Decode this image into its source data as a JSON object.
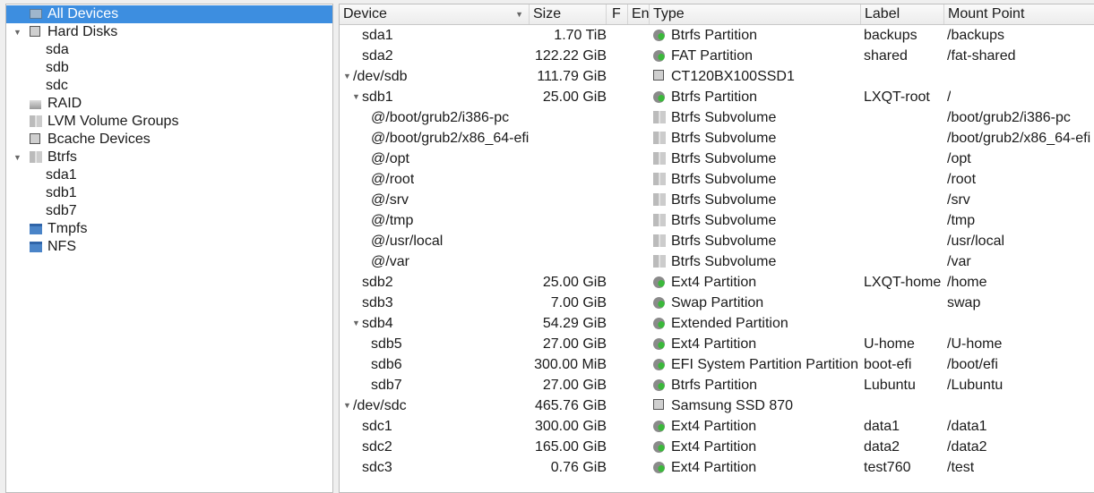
{
  "sidebar": {
    "items": [
      {
        "label": "All Devices",
        "icon": "monitor-icon",
        "level": 0,
        "selected": true
      },
      {
        "label": "Hard Disks",
        "icon": "disk-icon",
        "level": 0,
        "expanded": true
      },
      {
        "label": "sda",
        "level": 1
      },
      {
        "label": "sdb",
        "level": 1
      },
      {
        "label": "sdc",
        "level": 1
      },
      {
        "label": "RAID",
        "icon": "raid-icon",
        "level": 0
      },
      {
        "label": "LVM Volume Groups",
        "icon": "lvm-icon",
        "level": 0
      },
      {
        "label": "Bcache Devices",
        "icon": "disk-icon",
        "level": 0
      },
      {
        "label": "Btrfs",
        "icon": "lvm-icon",
        "level": 0,
        "expanded": true
      },
      {
        "label": "sda1",
        "level": 1
      },
      {
        "label": "sdb1",
        "level": 1
      },
      {
        "label": "sdb7",
        "level": 1
      },
      {
        "label": "Tmpfs",
        "icon": "folder-icon",
        "level": 0
      },
      {
        "label": "NFS",
        "icon": "network-folder-icon",
        "level": 0
      }
    ]
  },
  "table": {
    "columns": [
      "Device",
      "Size",
      "F",
      "En",
      "Type",
      "Label",
      "Mount Point"
    ],
    "sort_column": "Device",
    "rows": [
      {
        "device": "sda1",
        "level": 1,
        "size": "1.70 TiB",
        "type": "Btrfs Partition",
        "icon": "partition",
        "label": "backups",
        "mount": "/backups"
      },
      {
        "device": "sda2",
        "level": 1,
        "size": "122.22 GiB",
        "type": "FAT Partition",
        "icon": "partition",
        "label": "shared",
        "mount": "/fat-shared"
      },
      {
        "device": "/dev/sdb",
        "level": 0,
        "expanded": true,
        "size": "111.79 GiB",
        "type": "CT120BX100SSD1",
        "icon": "disk",
        "label": "",
        "mount": ""
      },
      {
        "device": "sdb1",
        "level": 1,
        "expanded": true,
        "size": "25.00 GiB",
        "type": "Btrfs Partition",
        "icon": "partition",
        "label": "LXQT-root",
        "mount": "/"
      },
      {
        "device": "@/boot/grub2/i386-pc",
        "level": 2,
        "size": "",
        "type": "Btrfs Subvolume",
        "icon": "subvolume",
        "label": "",
        "mount": "/boot/grub2/i386-pc"
      },
      {
        "device": "@/boot/grub2/x86_64-efi",
        "level": 2,
        "size": "",
        "type": "Btrfs Subvolume",
        "icon": "subvolume",
        "label": "",
        "mount": "/boot/grub2/x86_64-efi"
      },
      {
        "device": "@/opt",
        "level": 2,
        "size": "",
        "type": "Btrfs Subvolume",
        "icon": "subvolume",
        "label": "",
        "mount": "/opt"
      },
      {
        "device": "@/root",
        "level": 2,
        "size": "",
        "type": "Btrfs Subvolume",
        "icon": "subvolume",
        "label": "",
        "mount": "/root"
      },
      {
        "device": "@/srv",
        "level": 2,
        "size": "",
        "type": "Btrfs Subvolume",
        "icon": "subvolume",
        "label": "",
        "mount": "/srv"
      },
      {
        "device": "@/tmp",
        "level": 2,
        "size": "",
        "type": "Btrfs Subvolume",
        "icon": "subvolume",
        "label": "",
        "mount": "/tmp"
      },
      {
        "device": "@/usr/local",
        "level": 2,
        "size": "",
        "type": "Btrfs Subvolume",
        "icon": "subvolume",
        "label": "",
        "mount": "/usr/local"
      },
      {
        "device": "@/var",
        "level": 2,
        "size": "",
        "type": "Btrfs Subvolume",
        "icon": "subvolume",
        "label": "",
        "mount": "/var"
      },
      {
        "device": "sdb2",
        "level": 1,
        "size": "25.00 GiB",
        "type": "Ext4 Partition",
        "icon": "partition",
        "label": "LXQT-home",
        "mount": "/home"
      },
      {
        "device": "sdb3",
        "level": 1,
        "size": "7.00 GiB",
        "type": "Swap Partition",
        "icon": "partition",
        "label": "",
        "mount": "swap"
      },
      {
        "device": "sdb4",
        "level": 1,
        "expanded": true,
        "size": "54.29 GiB",
        "type": "Extended Partition",
        "icon": "partition",
        "label": "",
        "mount": ""
      },
      {
        "device": "sdb5",
        "level": 2,
        "size": "27.00 GiB",
        "type": "Ext4 Partition",
        "icon": "partition",
        "label": "U-home",
        "mount": "/U-home"
      },
      {
        "device": "sdb6",
        "level": 2,
        "size": "300.00 MiB",
        "type": "EFI System Partition Partition",
        "icon": "partition",
        "label": "boot-efi",
        "mount": "/boot/efi"
      },
      {
        "device": "sdb7",
        "level": 2,
        "size": "27.00 GiB",
        "type": "Btrfs Partition",
        "icon": "partition",
        "label": "Lubuntu",
        "mount": "/Lubuntu"
      },
      {
        "device": "/dev/sdc",
        "level": 0,
        "expanded": true,
        "size": "465.76 GiB",
        "type": "Samsung SSD 870",
        "icon": "disk",
        "label": "",
        "mount": ""
      },
      {
        "device": "sdc1",
        "level": 1,
        "size": "300.00 GiB",
        "type": "Ext4 Partition",
        "icon": "partition",
        "label": "data1",
        "mount": "/data1"
      },
      {
        "device": "sdc2",
        "level": 1,
        "size": "165.00 GiB",
        "type": "Ext4 Partition",
        "icon": "partition",
        "label": "data2",
        "mount": "/data2"
      },
      {
        "device": "sdc3",
        "level": 1,
        "size": "0.76 GiB",
        "type": "Ext4 Partition",
        "icon": "partition",
        "label": "test760",
        "mount": "/test"
      }
    ]
  }
}
